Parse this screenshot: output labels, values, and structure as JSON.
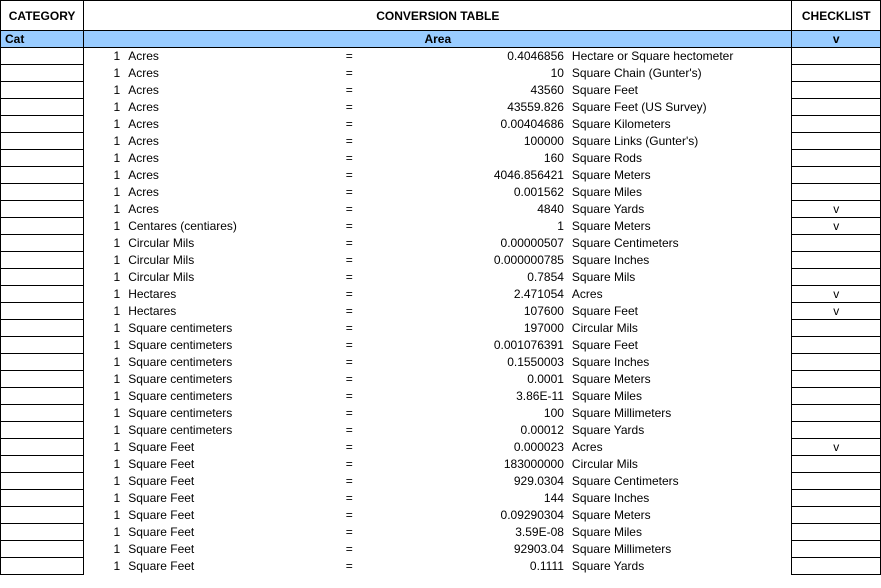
{
  "header": {
    "category": "CATEGORY",
    "title": "CONVERSION TABLE",
    "checklist": "CHECKLIST"
  },
  "subheader": {
    "cat": "Cat",
    "area": "Area",
    "v": "v"
  },
  "rows": [
    {
      "qty": "1",
      "from": "Acres",
      "eq": "=",
      "val": "0.4046856",
      "to": "Hectare or Square hectometer",
      "chk": ""
    },
    {
      "qty": "1",
      "from": "Acres",
      "eq": "=",
      "val": "10",
      "to": "Square Chain (Gunter's)",
      "chk": ""
    },
    {
      "qty": "1",
      "from": "Acres",
      "eq": "=",
      "val": "43560",
      "to": "Square Feet",
      "chk": ""
    },
    {
      "qty": "1",
      "from": "Acres",
      "eq": "=",
      "val": "43559.826",
      "to": "Square Feet (US Survey)",
      "chk": ""
    },
    {
      "qty": "1",
      "from": "Acres",
      "eq": "=",
      "val": "0.00404686",
      "to": "Square Kilometers",
      "chk": ""
    },
    {
      "qty": "1",
      "from": "Acres",
      "eq": "=",
      "val": "100000",
      "to": "Square Links (Gunter's)",
      "chk": ""
    },
    {
      "qty": "1",
      "from": "Acres",
      "eq": "=",
      "val": "160",
      "to": "Square Rods",
      "chk": ""
    },
    {
      "qty": "1",
      "from": "Acres",
      "eq": "=",
      "val": "4046.856421",
      "to": "Square Meters",
      "chk": ""
    },
    {
      "qty": "1",
      "from": "Acres",
      "eq": "=",
      "val": "0.001562",
      "to": "Square Miles",
      "chk": ""
    },
    {
      "qty": "1",
      "from": "Acres",
      "eq": "=",
      "val": "4840",
      "to": "Square Yards",
      "chk": "v"
    },
    {
      "qty": "1",
      "from": "Centares (centiares)",
      "eq": "=",
      "val": "1",
      "to": "Square Meters",
      "chk": "v"
    },
    {
      "qty": "1",
      "from": "Circular Mils",
      "eq": "=",
      "val": "0.00000507",
      "to": "Square Centimeters",
      "chk": ""
    },
    {
      "qty": "1",
      "from": "Circular Mils",
      "eq": "=",
      "val": "0.000000785",
      "to": "Square Inches",
      "chk": ""
    },
    {
      "qty": "1",
      "from": "Circular Mils",
      "eq": "=",
      "val": "0.7854",
      "to": "Square Mils",
      "chk": ""
    },
    {
      "qty": "1",
      "from": "Hectares",
      "eq": "=",
      "val": "2.471054",
      "to": "Acres",
      "chk": "v"
    },
    {
      "qty": "1",
      "from": "Hectares",
      "eq": "=",
      "val": "107600",
      "to": "Square Feet",
      "chk": "v"
    },
    {
      "qty": "1",
      "from": "Square centimeters",
      "eq": "=",
      "val": "197000",
      "to": "Circular Mils",
      "chk": ""
    },
    {
      "qty": "1",
      "from": "Square centimeters",
      "eq": "=",
      "val": "0.001076391",
      "to": "Square Feet",
      "chk": ""
    },
    {
      "qty": "1",
      "from": "Square centimeters",
      "eq": "=",
      "val": "0.1550003",
      "to": "Square Inches",
      "chk": ""
    },
    {
      "qty": "1",
      "from": "Square centimeters",
      "eq": "=",
      "val": "0.0001",
      "to": "Square Meters",
      "chk": ""
    },
    {
      "qty": "1",
      "from": "Square centimeters",
      "eq": "=",
      "val": "3.86E-11",
      "to": "Square Miles",
      "chk": ""
    },
    {
      "qty": "1",
      "from": "Square centimeters",
      "eq": "=",
      "val": "100",
      "to": "Square Millimeters",
      "chk": ""
    },
    {
      "qty": "1",
      "from": "Square centimeters",
      "eq": "=",
      "val": "0.00012",
      "to": "Square Yards",
      "chk": ""
    },
    {
      "qty": "1",
      "from": "Square Feet",
      "eq": "=",
      "val": "0.000023",
      "to": "Acres",
      "chk": "v"
    },
    {
      "qty": "1",
      "from": "Square Feet",
      "eq": "=",
      "val": "183000000",
      "to": "Circular Mils",
      "chk": ""
    },
    {
      "qty": "1",
      "from": "Square Feet",
      "eq": "=",
      "val": "929.0304",
      "to": "Square Centimeters",
      "chk": ""
    },
    {
      "qty": "1",
      "from": "Square Feet",
      "eq": "=",
      "val": "144",
      "to": "Square Inches",
      "chk": ""
    },
    {
      "qty": "1",
      "from": "Square Feet",
      "eq": "=",
      "val": "0.09290304",
      "to": "Square Meters",
      "chk": ""
    },
    {
      "qty": "1",
      "from": "Square Feet",
      "eq": "=",
      "val": "3.59E-08",
      "to": "Square Miles",
      "chk": ""
    },
    {
      "qty": "1",
      "from": "Square Feet",
      "eq": "=",
      "val": "92903.04",
      "to": "Square Millimeters",
      "chk": ""
    },
    {
      "qty": "1",
      "from": "Square Feet",
      "eq": "=",
      "val": "0.1111",
      "to": "Square Yards",
      "chk": ""
    }
  ]
}
